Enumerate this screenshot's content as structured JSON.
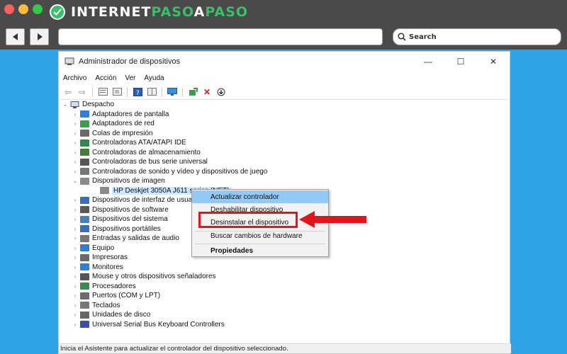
{
  "browser": {
    "logo": {
      "part1": "INTERNET",
      "part2": "PASO",
      "part3": "A",
      "part4": "PASO"
    },
    "search_placeholder": "Search"
  },
  "window": {
    "title": "Administrador de dispositivos",
    "menu": [
      "Archivo",
      "Acción",
      "Ver",
      "Ayuda"
    ],
    "root": "Despacho",
    "tree": [
      {
        "label": "Adaptadores de pantalla",
        "color": "#2f7fd8"
      },
      {
        "label": "Adaptadores de red",
        "color": "#3a9f4a"
      },
      {
        "label": "Colas de impresión",
        "color": "#6a6a6a"
      },
      {
        "label": "Controladoras ATA/ATAPI IDE",
        "color": "#2f8a4a"
      },
      {
        "label": "Controladoras de almacenamiento",
        "color": "#4a7a3a"
      },
      {
        "label": "Controladoras de bus serie universal",
        "color": "#555555"
      },
      {
        "label": "Controladoras de sonido y vídeo y dispositivos de juego",
        "color": "#777777"
      },
      {
        "label": "Dispositivos de imagen",
        "color": "#8a8a8a"
      },
      {
        "label": "HP Deskjet 3050A J611 series (NET)",
        "color": "#8a8a8a"
      },
      {
        "label": "Dispositivos de interfaz de usuario",
        "color": "#3a6fb8"
      },
      {
        "label": "Dispositivos de software",
        "color": "#5a5a5a"
      },
      {
        "label": "Dispositivos del sistema",
        "color": "#4a7fb8"
      },
      {
        "label": "Dispositivos portátiles",
        "color": "#3a6fb8"
      },
      {
        "label": "Entradas y salidas de audio",
        "color": "#777777"
      },
      {
        "label": "Equipo",
        "color": "#2f7fd8"
      },
      {
        "label": "Impresoras",
        "color": "#6a6a6a"
      },
      {
        "label": "Monitores",
        "color": "#2f7fd8"
      },
      {
        "label": "Mouse y otros dispositivos señaladores",
        "color": "#555555"
      },
      {
        "label": "Procesadores",
        "color": "#3a8a4a"
      },
      {
        "label": "Puertos (COM y LPT)",
        "color": "#6a6a6a"
      },
      {
        "label": "Teclados",
        "color": "#777777"
      },
      {
        "label": "Unidades de disco",
        "color": "#666666"
      },
      {
        "label": "Universal Serial Bus Keyboard Controllers",
        "color": "#3a4fa8"
      }
    ],
    "status": "Inicia el Asistente para actualizar el controlador del dispositivo seleccionado."
  },
  "context_menu": {
    "items": [
      "Actualizar controlador",
      "Deshabilitar dispositivo",
      "Desinstalar el dispositivo",
      "Buscar cambios de hardware",
      "Propiedades"
    ]
  },
  "colors": {
    "highlight": "#e3141b",
    "background": "#2fa3e6",
    "menu_hover": "#91c9f7"
  }
}
